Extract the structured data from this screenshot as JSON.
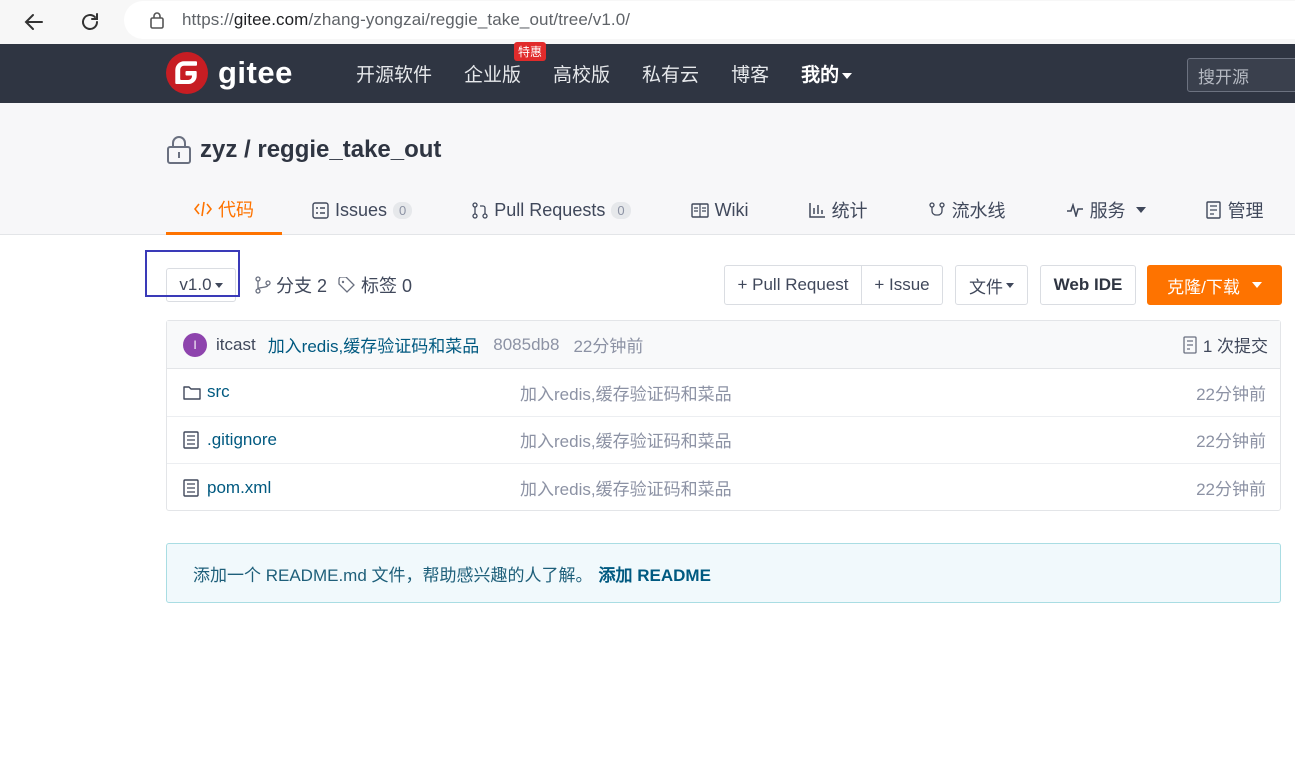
{
  "browser": {
    "url_prefix": "https://",
    "url_host": "gitee.com",
    "url_path": "/zhang-yongzai/reggie_take_out/tree/v1.0/"
  },
  "header": {
    "logo_text": "gitee",
    "nav": [
      {
        "label": "开源软件"
      },
      {
        "label": "企业版",
        "badge": "特惠"
      },
      {
        "label": "高校版"
      },
      {
        "label": "私有云"
      },
      {
        "label": "博客"
      },
      {
        "label": "我的"
      }
    ],
    "search_placeholder": "搜开源"
  },
  "repo": {
    "title": "zyz / reggie_take_out",
    "tabs": [
      {
        "label": "代码",
        "icon": "code-icon",
        "active": true
      },
      {
        "label": "Issues",
        "icon": "issues-icon",
        "count": "0"
      },
      {
        "label": "Pull Requests",
        "icon": "pull-request-icon",
        "count": "0"
      },
      {
        "label": "Wiki",
        "icon": "wiki-icon"
      },
      {
        "label": "统计",
        "icon": "stats-icon"
      },
      {
        "label": "流水线",
        "icon": "pipeline-icon"
      },
      {
        "label": "服务",
        "icon": "service-icon"
      },
      {
        "label": "管理",
        "icon": "manage-icon"
      }
    ]
  },
  "toolbar": {
    "branch": "v1.0",
    "branches": "分支 2",
    "tags": "标签 0",
    "pull_request_btn": "+ Pull Request",
    "issue_btn": "+ Issue",
    "file_btn": "文件",
    "web_ide_btn": "Web IDE",
    "clone_btn": "克隆/下载"
  },
  "commit": {
    "avatar_letter": "I",
    "author": "itcast",
    "message": "加入redis,缓存验证码和菜品",
    "sha": "8085db8",
    "time": "22分钟前",
    "commit_count": "1 次提交"
  },
  "files": [
    {
      "name": "src",
      "type": "folder",
      "message": "加入redis,缓存验证码和菜品",
      "time": "22分钟前"
    },
    {
      "name": ".gitignore",
      "type": "file",
      "message": "加入redis,缓存验证码和菜品",
      "time": "22分钟前"
    },
    {
      "name": "pom.xml",
      "type": "file",
      "message": "加入redis,缓存验证码和菜品",
      "time": "22分钟前"
    }
  ],
  "readme": {
    "text": "添加一个 README.md 文件，帮助感兴趣的人了解。",
    "link": "添加 README"
  },
  "colors": {
    "accent": "#fe7300",
    "header_bg": "#2f3542",
    "link": "#005980"
  }
}
